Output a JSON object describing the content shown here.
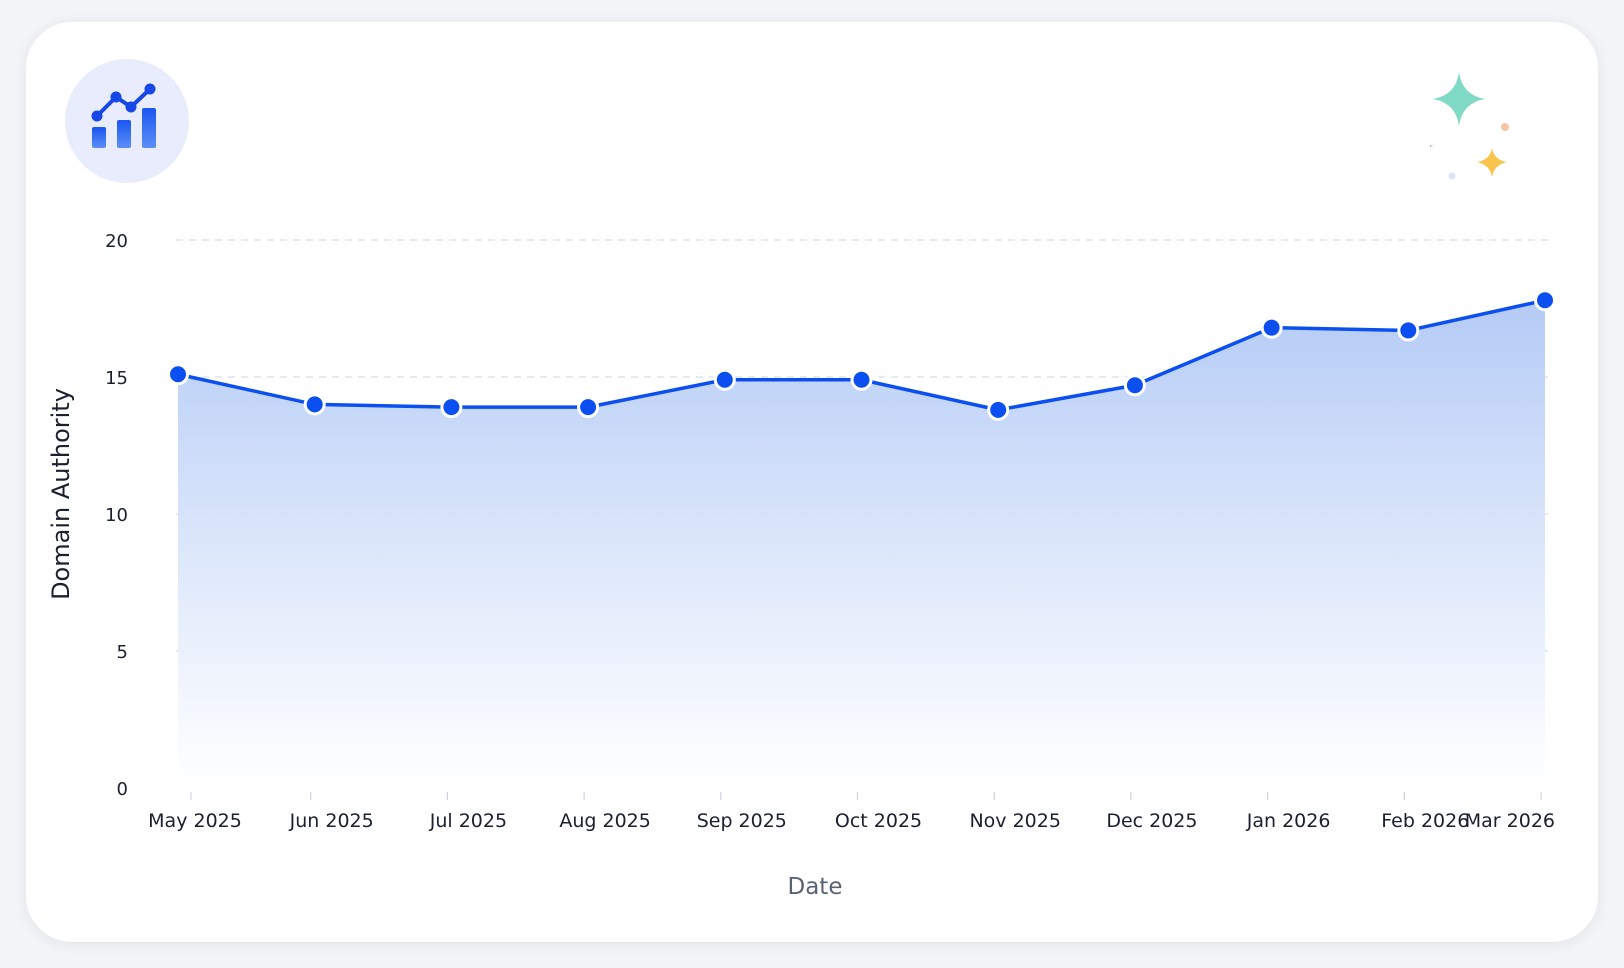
{
  "chart_data": {
    "type": "area",
    "x": [
      "May 2025",
      "Jun 2025",
      "Jul 2025",
      "Aug 2025",
      "Sep 2025",
      "Oct 2025",
      "Nov 2025",
      "Dec 2025",
      "Jan 2026",
      "Feb 2026",
      "Mar 2026"
    ],
    "values": [
      15.1,
      14.0,
      13.9,
      13.9,
      14.9,
      14.9,
      13.8,
      14.7,
      16.8,
      16.7,
      17.8
    ],
    "xlabel": "Date",
    "ylabel": "Domain Authority",
    "ylim": [
      0,
      20
    ],
    "yticks": [
      0,
      5,
      10,
      15,
      20
    ],
    "grid": "horizontal dashed",
    "legend": "none",
    "colors": {
      "line": "#0b4ff0",
      "fill_top": "#b6cdf7",
      "y_axis_gradient": [
        "#6fe0c8",
        "#b497f5",
        "#f29bbd",
        "#f8c14e"
      ],
      "x_axis_gradient": [
        "#b49cf6",
        "#7ab4f5",
        "#8fdbc8",
        "#f5c36b",
        "#f28fb8"
      ]
    }
  },
  "icons": {
    "badge": "chart-growth-icon",
    "decoration": "sparkles-icon"
  }
}
